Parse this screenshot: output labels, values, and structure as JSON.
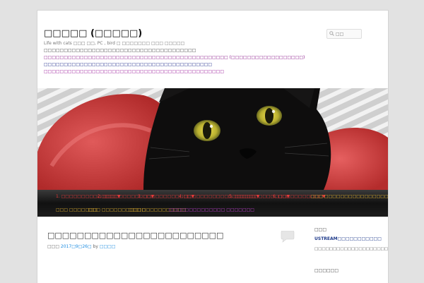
{
  "site": {
    "title": "□□□□□ (□□□□□)",
    "description": "Life with cats □□□ □□, PC , bird □ □□□□□□□ □□□ □□□□□",
    "lines": [
      {
        "text": "□□□□□□□□□□□□□□□□□□□□□□□□□□□□□□□□□□□□□□",
        "color": "#444444"
      },
      {
        "text": "□□□□□□□□□□□□□□□□□□□□□□□□□□□□□□□□□□□□□□□□□□□□□□ (□□□□□□□□□□□□□□□□□□)",
        "color": "#8b1a8b"
      },
      {
        "text": "□□□□□□□□□□□□□□□□□□□□□□□□□□□□□□□□□□□□□□□□□□",
        "color": "#1e2a8a"
      },
      {
        "text": "□□□□□□□□□□□□□□□□□□□□□□□□□□□□□□□□□□□□□□□□□□□□□",
        "color": "#9b1a9b"
      }
    ]
  },
  "search": {
    "placeholder": "□□"
  },
  "nav": {
    "row1": [
      {
        "label": "1. □□□□□□□□□□□□□□▼",
        "color": "#e63a3a"
      },
      {
        "label": "2. □□□□□□□□□□□□▼",
        "color": "#e63a3a"
      },
      {
        "label": "3. □□□□□□□□□□□□▼",
        "color": "#e63a3a"
      },
      {
        "label": "4. □□□□□□□□□□□□□□□□□□▼",
        "color": "#e63a3a"
      },
      {
        "label": "5. □□□□□□□□□□□□□▼",
        "color": "#e63a3a"
      },
      {
        "label": "6. □□□□□□□□□□□▼",
        "color": "#e63a3a"
      },
      {
        "label": "□□□ □□□□□□□□□□□□□□□□□□▼",
        "color": "#e0b030"
      }
    ],
    "row2": [
      {
        "label": "□□□ □□□□□□□",
        "color": "#e0b030"
      },
      {
        "label": "□□□ □□□□□□□□□□□",
        "color": "#e0b030"
      },
      {
        "label": "□□□ □□□□□□□□□□□",
        "color": "#e0b030"
      },
      {
        "label": "□□□□□□□□□□□□□□ □□□□□□□",
        "color": "#c040d0"
      }
    ]
  },
  "post": {
    "title": "□□□□□□□□□□□□□□□□□□□□□□□□",
    "meta_prefix": "□□□ ",
    "date": "2017□9□26□",
    "meta_by": " by ",
    "author": "□□□□"
  },
  "sidebar": {
    "widget1_title": "□□□",
    "widget1_link": "USTREAM□□□□□□□□□□□",
    "widget1_text": "□□□□□□□□□□□□□□□□□□□□□□□5□□□□□□□□□□□□□□□□□□□□□□□□□□□□□□□□□□□□□□□",
    "widget2_title": "□□□□□□"
  },
  "colors": {
    "link": "#1b8be0",
    "nav_red": "#e63a3a",
    "nav_gold": "#e0b030"
  }
}
